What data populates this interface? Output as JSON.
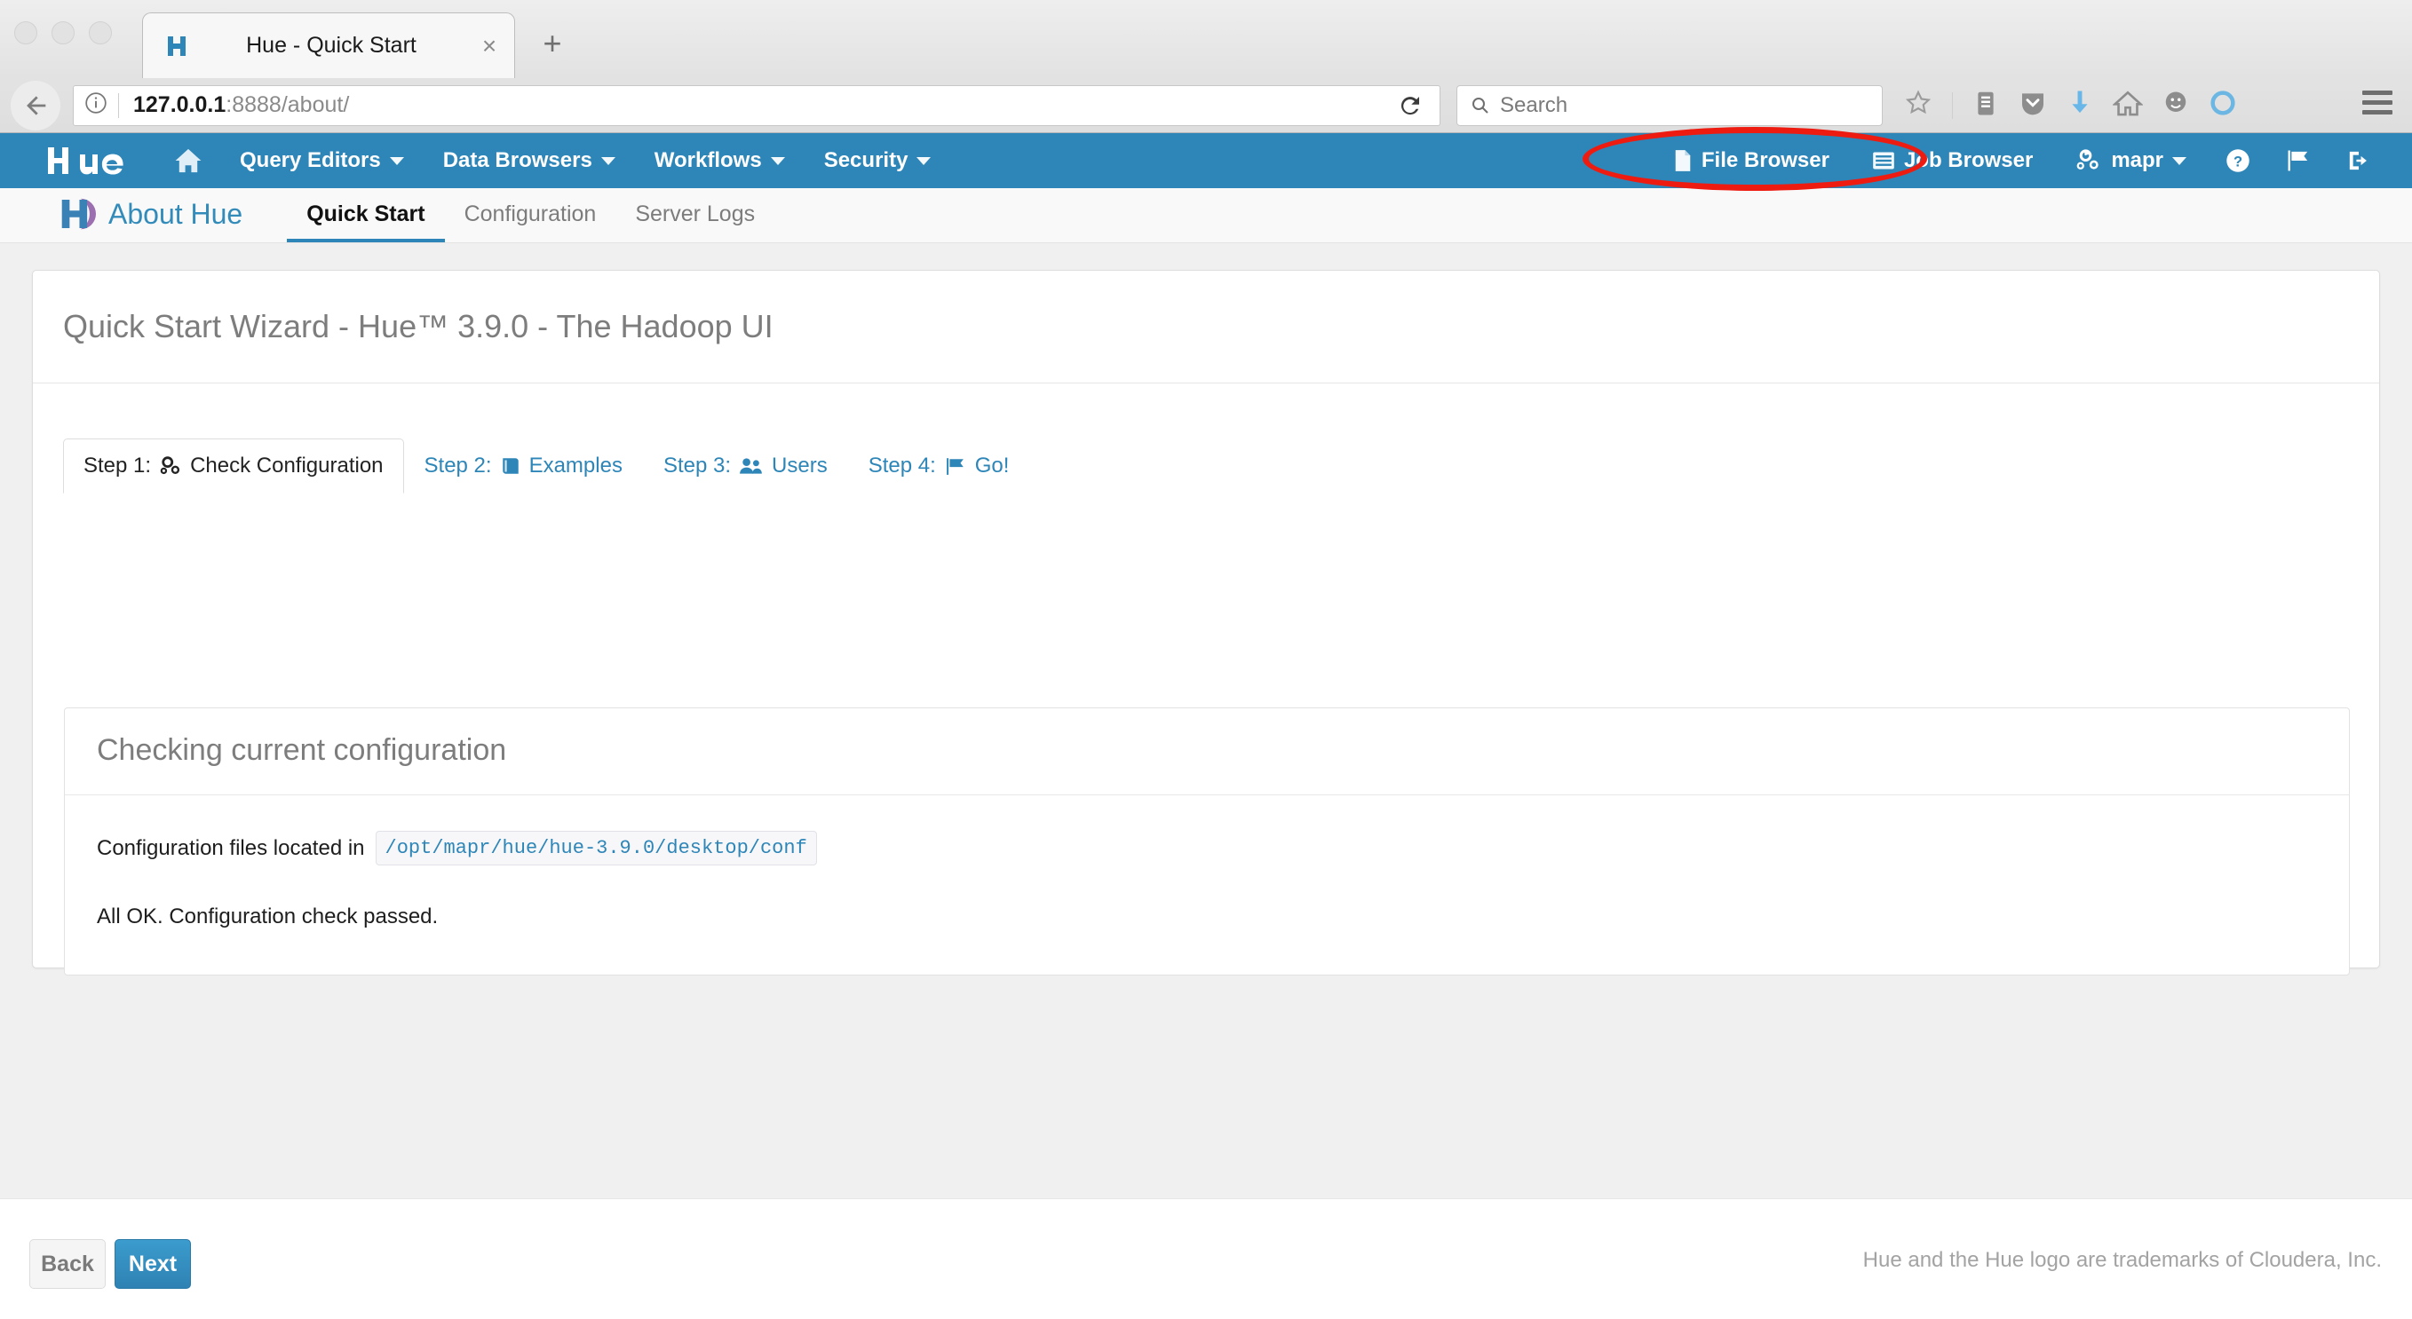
{
  "browser": {
    "tab": {
      "title": "Hue - Quick Start",
      "favicon": "hue-logo-icon",
      "close": "×"
    },
    "new_tab": "+",
    "back_icon": "back-arrow-icon",
    "info_icon": "ⓘ",
    "url": {
      "host": "127.0.0.1",
      "rest": ":8888/about/",
      "full": "127.0.0.1:8888/about/"
    },
    "reload_icon": "reload-icon",
    "search": {
      "placeholder": "Search",
      "icon": "search-icon"
    },
    "toolbar_icons": [
      "bookmark-star-icon",
      "library-icon",
      "pocket-shield-icon",
      "download-arrow-icon",
      "home-icon",
      "smiley-face-icon",
      "sync-circle-icon"
    ],
    "menu_icon": "hamburger-menu-icon"
  },
  "hue_nav": {
    "brand": "hue",
    "home_icon": "home-icon",
    "items": [
      {
        "label": "Query Editors",
        "caret": true
      },
      {
        "label": "Data Browsers",
        "caret": true
      },
      {
        "label": "Workflows",
        "caret": true
      },
      {
        "label": "Security",
        "caret": true
      }
    ],
    "right_items": [
      {
        "label": "File Browser",
        "icon": "file-icon",
        "caret": false
      },
      {
        "label": "Job Browser",
        "icon": "list-icon",
        "caret": false
      },
      {
        "label": "mapr",
        "icon": "gears-icon",
        "caret": true
      }
    ],
    "right_icons": [
      "help-circle-icon",
      "flag-icon",
      "sign-out-icon"
    ]
  },
  "subnav": {
    "brand_label": "About Hue",
    "brand_icon": "hue-logo-icon",
    "tabs": [
      {
        "label": "Quick Start",
        "active": true
      },
      {
        "label": "Configuration",
        "active": false
      },
      {
        "label": "Server Logs",
        "active": false
      }
    ]
  },
  "main": {
    "title": "Quick Start Wizard - Hue™ 3.9.0 - The Hadoop UI",
    "step_tabs": [
      {
        "label": "Step 1:",
        "name": "Check Configuration",
        "icon": "gears-icon",
        "active": true
      },
      {
        "label": "Step 2:",
        "name": "Examples",
        "icon": "book-icon",
        "active": false
      },
      {
        "label": "Step 3:",
        "name": "Users",
        "icon": "users-icon",
        "active": false
      },
      {
        "label": "Step 4:",
        "name": "Go!",
        "icon": "flag-icon",
        "active": false
      }
    ],
    "panel": {
      "heading": "Checking current configuration",
      "config_label": "Configuration files located in",
      "config_path": "/opt/mapr/hue/hue-3.9.0/desktop/conf",
      "status": "All OK. Configuration check passed."
    }
  },
  "footer": {
    "back_label": "Back",
    "next_label": "Next",
    "note": "Hue and the Hue logo are trademarks of Cloudera, Inc."
  },
  "annotation": {
    "shape": "red-ellipse",
    "color": "#ee1b11",
    "target": "File Browser"
  }
}
